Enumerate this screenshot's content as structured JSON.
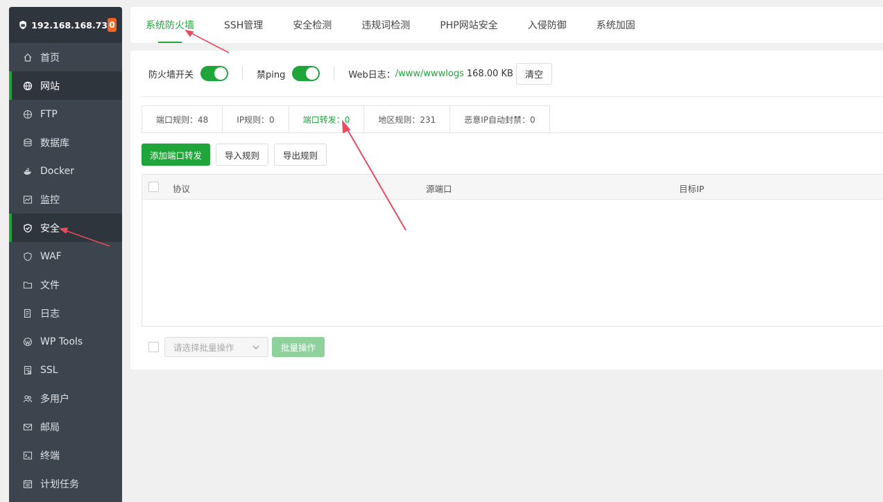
{
  "sidebar": {
    "server_ip": "192.168.168.73",
    "badge": "0",
    "items": [
      {
        "label": "首页",
        "icon": "home-icon"
      },
      {
        "label": "网站",
        "icon": "globe-icon"
      },
      {
        "label": "FTP",
        "icon": "ftp-globe-icon"
      },
      {
        "label": "数据库",
        "icon": "database-icon"
      },
      {
        "label": "Docker",
        "icon": "docker-icon"
      },
      {
        "label": "监控",
        "icon": "monitor-chart-icon"
      },
      {
        "label": "安全",
        "icon": "shield-check-icon"
      },
      {
        "label": "WAF",
        "icon": "waf-shield-icon"
      },
      {
        "label": "文件",
        "icon": "folder-icon"
      },
      {
        "label": "日志",
        "icon": "log-file-icon"
      },
      {
        "label": "WP Tools",
        "icon": "wordpress-icon"
      },
      {
        "label": "SSL",
        "icon": "certificate-icon"
      },
      {
        "label": "多用户",
        "icon": "users-icon"
      },
      {
        "label": "邮局",
        "icon": "mail-icon"
      },
      {
        "label": "终端",
        "icon": "terminal-icon"
      },
      {
        "label": "计划任务",
        "icon": "calendar-icon"
      }
    ]
  },
  "tabs": [
    "系统防火墙",
    "SSH管理",
    "安全检测",
    "违规词检测",
    "PHP网站安全",
    "入侵防御",
    "系统加固"
  ],
  "toolbar": {
    "firewall_label": "防火墙开关",
    "ping_label": "禁ping",
    "weblog_label": "Web日志：",
    "weblog_path": "/www/wwwlogs",
    "weblog_size": "168.00 KB",
    "clear_label": "清空"
  },
  "subtabs": [
    "端口规则：48",
    "IP规则：0",
    "端口转发：0",
    "地区规则：231",
    "恶意IP自动封禁：0"
  ],
  "actions": {
    "add": "添加端口转发",
    "import": "导入规则",
    "export": "导出规则"
  },
  "table": {
    "columns": [
      "协议",
      "源端口",
      "目标IP"
    ]
  },
  "footer": {
    "select_placeholder": "请选择批量操作",
    "batch_label": "批量操作"
  },
  "colors": {
    "accent": "#20a53a",
    "sidebar_bg": "#3c444d",
    "badge": "#f0641f",
    "annotation": "#e84a5f"
  }
}
